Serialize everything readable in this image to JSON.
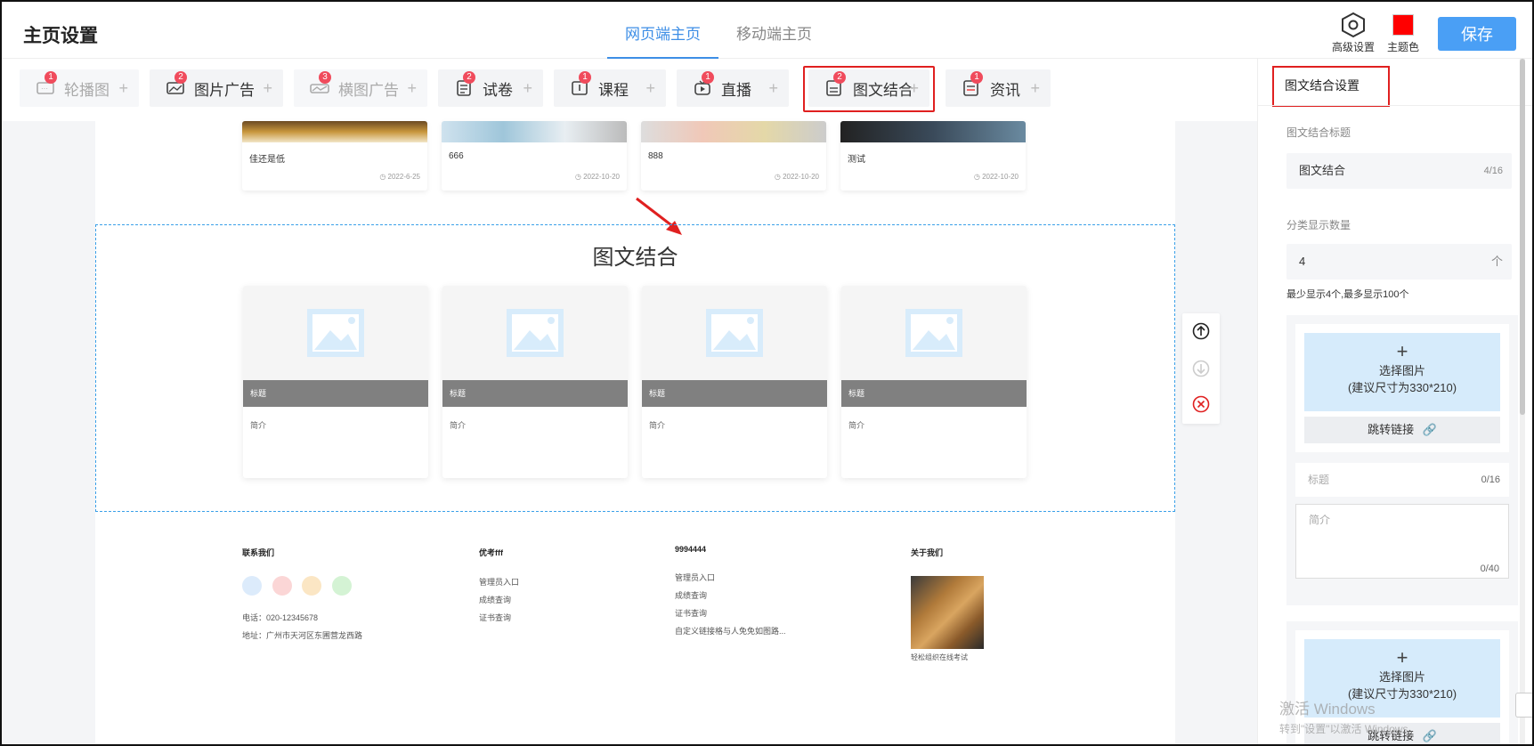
{
  "header": {
    "title": "主页设置",
    "tabs": [
      {
        "label": "网页端主页"
      },
      {
        "label": "移动端主页"
      }
    ],
    "advanced_label": "高级设置",
    "theme_label": "主题色",
    "theme_color": "#ff0000",
    "save_label": "保存"
  },
  "components": [
    {
      "label": "轮播图",
      "badge": "1",
      "icon": "carousel-icon",
      "disabled": true
    },
    {
      "label": "图片广告",
      "badge": "2",
      "icon": "image-ad-icon"
    },
    {
      "label": "横图广告",
      "badge": "3",
      "icon": "banner-ad-icon",
      "disabled": true
    },
    {
      "label": "试卷",
      "badge": "2",
      "icon": "exam-icon"
    },
    {
      "label": "课程",
      "badge": "1",
      "icon": "course-icon"
    },
    {
      "label": "直播",
      "badge": "1",
      "icon": "live-icon"
    },
    {
      "label": "图文结合",
      "badge": "2",
      "icon": "image-text-icon",
      "highlighted": true
    },
    {
      "label": "资讯",
      "badge": "1",
      "icon": "news-icon"
    }
  ],
  "news_cards": [
    {
      "title": "佳还是低",
      "date": "◷ 2022-6-25"
    },
    {
      "title": "666",
      "date": "◷ 2022-10-20"
    },
    {
      "title": "888",
      "date": "◷ 2022-10-20"
    },
    {
      "title": "测试",
      "date": "◷ 2022-10-20"
    }
  ],
  "image_text_block": {
    "title": "图文结合",
    "cards": [
      {
        "bar": "标题",
        "desc": "简介"
      },
      {
        "bar": "标题",
        "desc": "简介"
      },
      {
        "bar": "标题",
        "desc": "简介"
      },
      {
        "bar": "标题",
        "desc": "简介"
      }
    ]
  },
  "footer": {
    "contact": {
      "heading": "联系我们",
      "phone": "电话：020-12345678",
      "address": "地址：广州市天河区东圃营龙西路"
    },
    "col2": {
      "heading": "优考fff",
      "links": [
        "管理员入口",
        "成绩查询",
        "证书查询"
      ]
    },
    "col3": {
      "heading": "9994444",
      "links": [
        "管理员入口",
        "成绩查询",
        "证书查询",
        "自定义链接格与人免免如图路..."
      ]
    },
    "about": {
      "heading": "关于我们",
      "caption": "轻松组织在线考试"
    }
  },
  "settings": {
    "panel_title": "图文结合设置",
    "title_label": "图文结合标题",
    "title_value": "图文结合",
    "title_count": "4/16",
    "count_label": "分类显示数量",
    "count_value": "4",
    "count_unit": "个",
    "count_hint": "最少显示4个,最多显示100个",
    "items": [
      {
        "upload_label": "选择图片",
        "upload_size": "(建议尺寸为330*210)",
        "link_label": "跳转链接",
        "title_placeholder": "标题",
        "title_count": "0/16",
        "desc_placeholder": "简介",
        "desc_count": "0/40"
      },
      {
        "upload_label": "选择图片",
        "upload_size": "(建议尺寸为330*210)",
        "link_label": "跳转链接"
      }
    ]
  },
  "watermark": {
    "line1": "激活 Windows",
    "line2": "转到\"设置\"以激活 Windows。"
  }
}
